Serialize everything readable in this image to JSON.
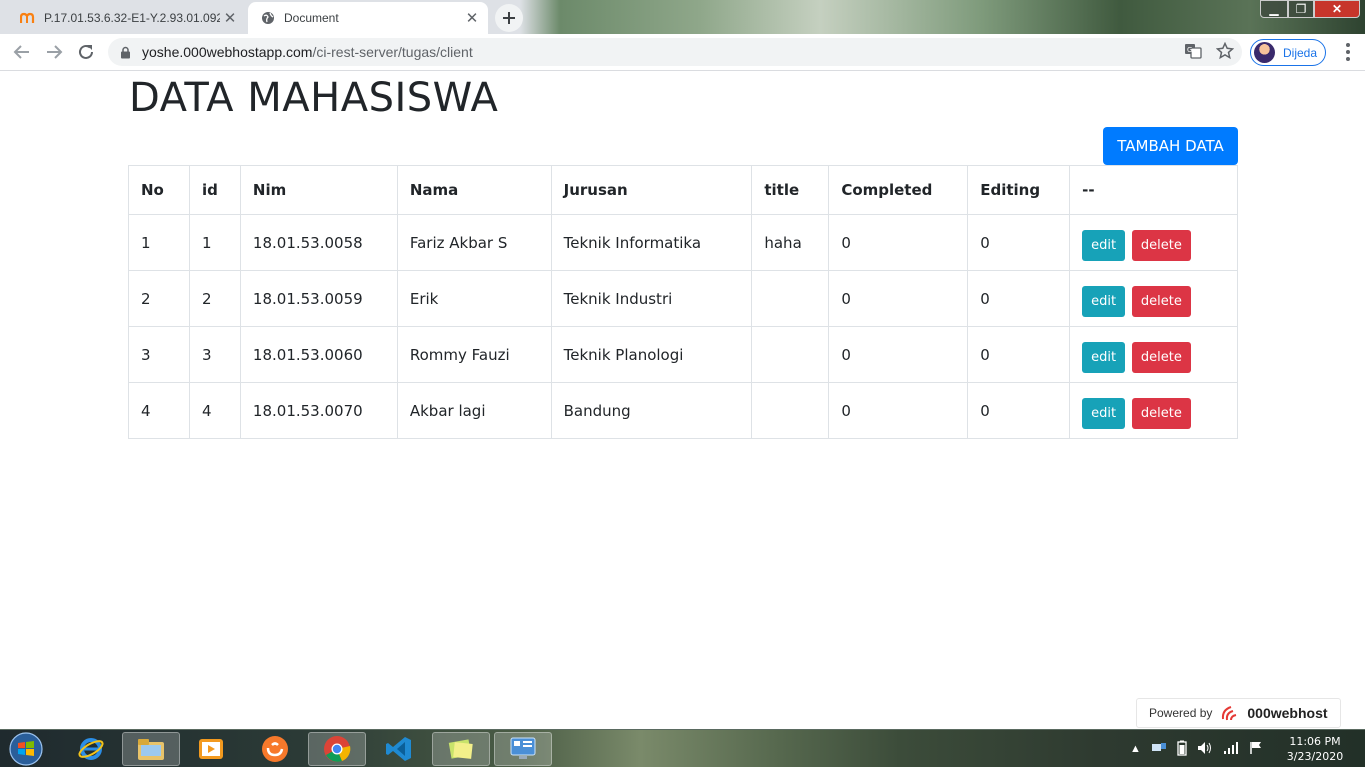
{
  "browser": {
    "tabs": [
      {
        "title": "P.17.01.53.6.32-E1-Y.2.93.01.092-",
        "active": false
      },
      {
        "title": "Document",
        "active": true
      }
    ],
    "url_host": "yoshe.000webhostapp.com",
    "url_path": "/ci-rest-server/tugas/client",
    "profile_name": "Dijeda"
  },
  "page": {
    "title": "DATA MAHASISWA",
    "add_button_label": "TAMBAH DATA",
    "table": {
      "headers": [
        "No",
        "id",
        "Nim",
        "Nama",
        "Jurusan",
        "title",
        "Completed",
        "Editing",
        "--"
      ],
      "rows": [
        {
          "no": "1",
          "id": "1",
          "nim": "18.01.53.0058",
          "nama": "Fariz Akbar S",
          "jurusan": "Teknik Informatika",
          "title": "haha",
          "completed": "0",
          "editing": "0"
        },
        {
          "no": "2",
          "id": "2",
          "nim": "18.01.53.0059",
          "nama": "Erik",
          "jurusan": "Teknik Industri",
          "title": "",
          "completed": "0",
          "editing": "0"
        },
        {
          "no": "3",
          "id": "3",
          "nim": "18.01.53.0060",
          "nama": "Rommy Fauzi",
          "jurusan": "Teknik Planologi",
          "title": "",
          "completed": "0",
          "editing": "0"
        },
        {
          "no": "4",
          "id": "4",
          "nim": "18.01.53.0070",
          "nama": "Akbar lagi",
          "jurusan": "Bandung",
          "title": "",
          "completed": "0",
          "editing": "0"
        }
      ],
      "edit_label": "edit",
      "delete_label": "delete"
    },
    "powered_by": {
      "label": "Powered by",
      "brand": "000webhost"
    }
  },
  "taskbar": {
    "time": "11:06 PM",
    "date": "3/23/2020",
    "items": [
      "file-explorer",
      "internet-explorer",
      "explorer-folder",
      "media-player",
      "uc-browser",
      "chrome",
      "vscode",
      "notes-app",
      "control-panel"
    ]
  },
  "colors": {
    "primary": "#007bff",
    "info": "#17a2b8",
    "danger": "#dc3545",
    "text": "#212529",
    "border": "#dee2e6"
  }
}
